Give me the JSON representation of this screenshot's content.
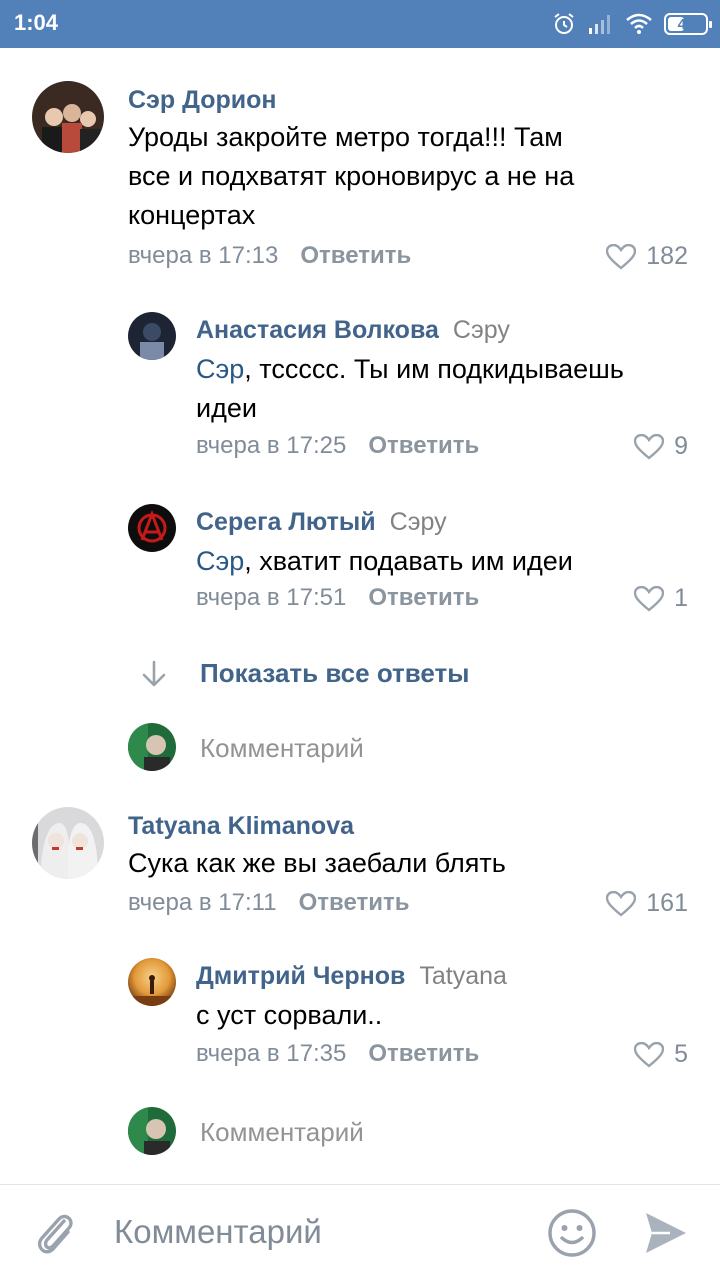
{
  "status_bar": {
    "time": "1:04",
    "battery": "41"
  },
  "comments": [
    {
      "author": "Сэр Дорион",
      "lines": [
        "Уроды закройте метро тогда!!! Там",
        "все и подхватят кроновирус а не на",
        "концертах"
      ],
      "time": "вчера в 17:13",
      "reply_label": "Ответить",
      "likes": "182",
      "avatar_colors": [
        "#3a2a22",
        "#b84a3c",
        "#e8c9b0"
      ]
    },
    {
      "author": "Анастасия Волкова",
      "reply_to": "Сэру",
      "mention": "Сэр",
      "lines": [
        ", тсссcс. Ты им подкидываешь",
        "идеи"
      ],
      "time": "вчера в 17:25",
      "reply_label": "Ответить",
      "likes": "9",
      "avatar_colors": [
        "#1d2433",
        "#3b4b66",
        "#7b8aa6"
      ]
    },
    {
      "author": "Серега Лютый",
      "reply_to": "Сэру",
      "mention": "Сэр",
      "lines": [
        ", хватит подавать им идеи"
      ],
      "time": "вчера в 17:51",
      "reply_label": "Ответить",
      "likes": "1",
      "avatar_colors": [
        "#0d0d0d",
        "#c41a1a"
      ]
    },
    {
      "author": "Tatyana Klimanova",
      "lines": [
        "Сука как же вы заебали блять"
      ],
      "time": "вчера в 17:11",
      "reply_label": "Ответить",
      "likes": "161",
      "avatar_colors": [
        "#d9d9db",
        "#6b6b70",
        "#c0392b"
      ]
    },
    {
      "author": "Дмитрий Чернов",
      "reply_to": "Tatyana",
      "lines": [
        "с уст сорвали.."
      ],
      "time": "вчера в 17:35",
      "reply_label": "Ответить",
      "likes": "5",
      "avatar_colors": [
        "#e39a3a",
        "#7a3d12",
        "#f5d08a"
      ]
    }
  ],
  "show_all_replies": "Показать все ответы",
  "inline_comment_placeholder": "Комментарий",
  "input_bar": {
    "placeholder": "Комментарий"
  },
  "colors": {
    "accent": "#5181b8",
    "link": "#42648b",
    "meta": "#818c99"
  }
}
